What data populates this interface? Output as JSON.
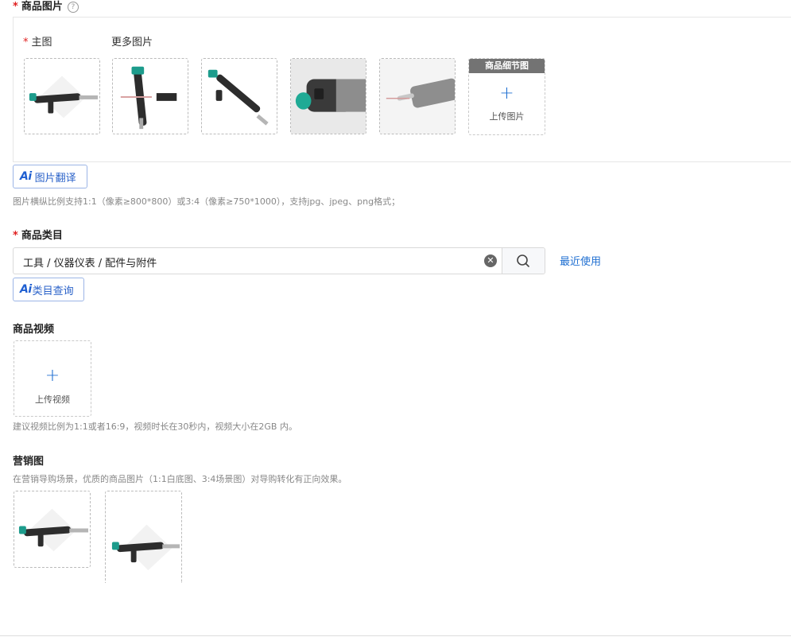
{
  "images": {
    "title": "商品图片",
    "required_mark": "*",
    "help": "?",
    "main_label": "主图",
    "more_label": "更多图片",
    "detail_header": "商品细节图",
    "plus": "+",
    "upload_label": "上传图片",
    "thumbnails": [
      "injector-photo-1",
      "injector-photo-2",
      "injector-photo-3",
      "injector-photo-4",
      "injector-photo-5"
    ]
  },
  "ai_translate": {
    "ai": "Ai",
    "label": "图片翻译"
  },
  "images_hint": "图片横纵比例支持1:1（像素≥800*800）或3:4（像素≥750*1000），支持jpg、jpeg、png格式；",
  "category": {
    "title": "商品类目",
    "required_mark": "*",
    "value": "工具 / 仪器仪表 / 配件与附件",
    "clear": "✕",
    "recent": "最近使用"
  },
  "ai_category": {
    "ai": "Ai",
    "label": "类目查询"
  },
  "video": {
    "title": "商品视频",
    "plus": "+",
    "upload_label": "上传视频",
    "hint": "建议视频比例为1:1或者16:9，视频时长在30秒内，视频大小在2GB 内。"
  },
  "marketing": {
    "title": "营销图",
    "hint": "在营销导购场景，优质的商品图片（1:1白底图、3:4场景图）对导购转化有正向效果。"
  },
  "colors": {
    "accent": "#1f6fd1",
    "required": "#e02020",
    "detail_header_bg": "#737373"
  }
}
